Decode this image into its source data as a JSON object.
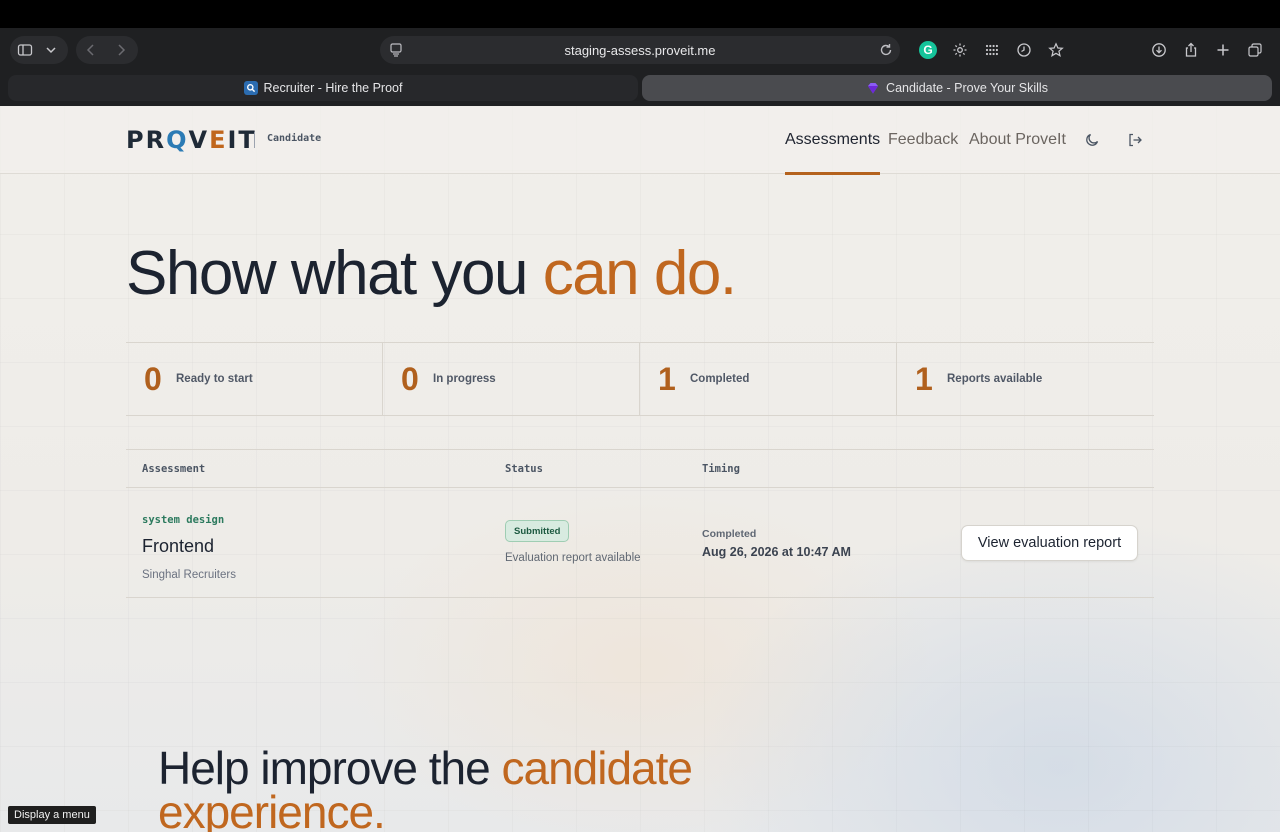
{
  "browser": {
    "url": "staging-assess.proveit.me",
    "tabs": [
      {
        "title": "Recruiter - Hire the Proof",
        "active": false,
        "favicon": "magnifier-badge-icon"
      },
      {
        "title": "Candidate - Prove Your Skills",
        "active": true,
        "favicon": "gem-icon"
      }
    ],
    "tooltip": "Display a menu"
  },
  "header": {
    "logo_parts": [
      "PR",
      "Q",
      "V",
      "E",
      "IT"
    ],
    "subtitle": "Candidate",
    "nav": [
      {
        "label": "Assessments",
        "active": true
      },
      {
        "label": "Feedback",
        "active": false
      },
      {
        "label": "About ProveIt",
        "active": false
      }
    ]
  },
  "hero": {
    "text": "Show what you ",
    "accent": "can do."
  },
  "stats": [
    {
      "value": "0",
      "label": "Ready to start"
    },
    {
      "value": "0",
      "label": "In progress"
    },
    {
      "value": "1",
      "label": "Completed"
    },
    {
      "value": "1",
      "label": "Reports available"
    }
  ],
  "table": {
    "columns": [
      "Assessment",
      "Status",
      "Timing"
    ],
    "rows": [
      {
        "tag": "system design",
        "title": "Frontend",
        "company": "Singhal Recruiters",
        "status_badge": "Submitted",
        "status_note": "Evaluation report available",
        "timing_label": "Completed",
        "timing_value": "Aug 26, 2026 at 10:47 AM",
        "action": "View evaluation report"
      }
    ]
  },
  "feedback_section": {
    "text": "Help improve the ",
    "accent_1": "candidate",
    "accent_2": "experience."
  },
  "colors": {
    "accent": "#c0671f",
    "brand_blue": "#2b7bb5",
    "badge_green": "#d8ebe0"
  }
}
